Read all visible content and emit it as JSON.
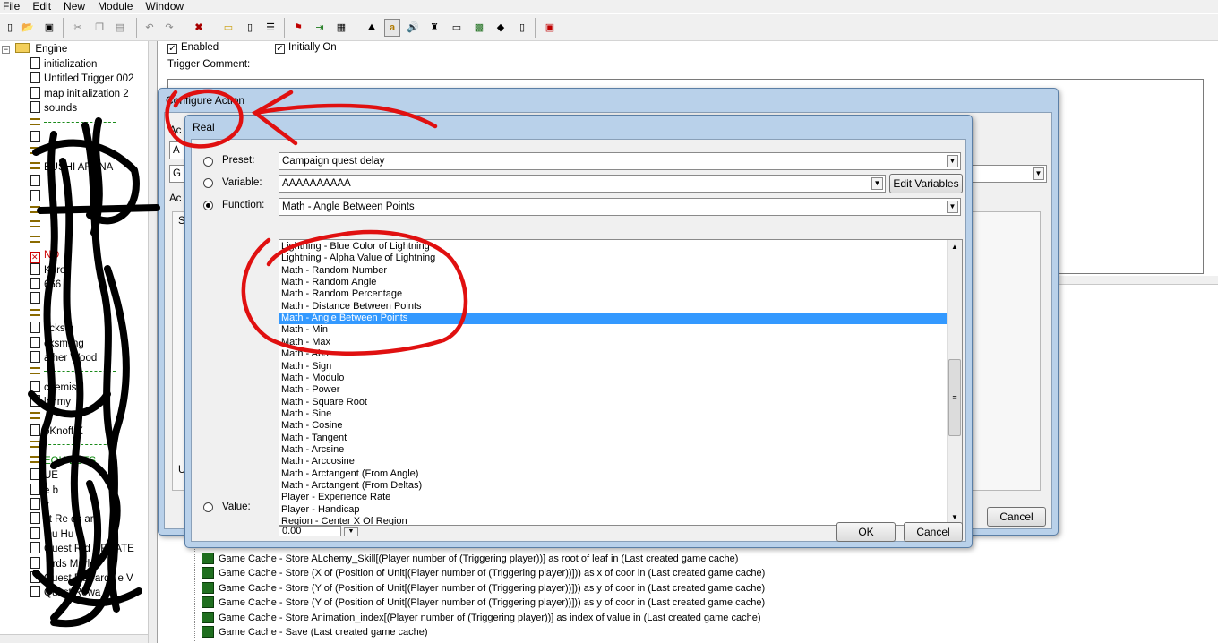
{
  "menu": [
    "File",
    "Edit",
    "New",
    "Module",
    "Window"
  ],
  "toolbar_icons": [
    "new-icon",
    "open-icon",
    "save-icon",
    "cut-icon",
    "copy-icon",
    "paste-icon",
    "undo-icon",
    "redo-icon",
    "close-icon",
    "folder-icon",
    "page-icon",
    "list-icon",
    "flag-icon",
    "export-icon",
    "clapper-icon",
    "terrain-icon",
    "font-icon",
    "sound-icon",
    "unit-icon",
    "map-icon",
    "script-icon",
    "cube-icon",
    "document-icon",
    "test-icon"
  ],
  "tree": {
    "root": "Engine",
    "items": [
      {
        "label": "initialization",
        "icon": "page"
      },
      {
        "label": "Untitled Trigger 002",
        "icon": "page"
      },
      {
        "label": "map initialization 2",
        "icon": "page"
      },
      {
        "label": "sounds",
        "icon": "page"
      },
      {
        "label": "",
        "icon": "comment-dash"
      },
      {
        "label": "",
        "icon": "page"
      },
      {
        "label": "",
        "icon": "comment"
      },
      {
        "label": "BUSHI ARENA",
        "icon": "comment"
      },
      {
        "label": "",
        "icon": "page"
      },
      {
        "label": "",
        "icon": "page"
      },
      {
        "label": "",
        "icon": "comment"
      },
      {
        "label": "",
        "icon": "comment"
      },
      {
        "label": "",
        "icon": "comment"
      },
      {
        "label": "NO",
        "icon": "disabled"
      },
      {
        "label": "Kero",
        "icon": "page"
      },
      {
        "label": "666",
        "icon": "page"
      },
      {
        "label": "",
        "icon": "page"
      },
      {
        "label": "",
        "icon": "comment-dash"
      },
      {
        "label": "acksm",
        "icon": "page"
      },
      {
        "label": "cksmiing",
        "icon": "page"
      },
      {
        "label": "ather Wood",
        "icon": "page"
      },
      {
        "label": "",
        "icon": "comment-dash"
      },
      {
        "label": "chemist",
        "icon": "page"
      },
      {
        "label": "lchmy",
        "icon": "page"
      },
      {
        "label": "",
        "icon": "comment-dash"
      },
      {
        "label": "oKnoff X",
        "icon": "page"
      },
      {
        "label": "",
        "icon": "comment-dash"
      },
      {
        "label": "EQU   ESTS",
        "icon": "comment"
      },
      {
        "label": "UE",
        "icon": "page"
      },
      {
        "label": "e b",
        "icon": "page"
      },
      {
        "label": "y",
        "icon": "page"
      },
      {
        "label": "st Re    ds ars",
        "icon": "page"
      },
      {
        "label": "Qu    Hu",
        "icon": "page"
      },
      {
        "label": "Quest R    d CREATE",
        "icon": "page"
      },
      {
        "label": "    ards Murloc",
        "icon": "page"
      },
      {
        "label": "Quest Rewards    e V",
        "icon": "page"
      },
      {
        "label": "Quest Rewa",
        "icon": "page"
      }
    ]
  },
  "trigger": {
    "enabled_label": "Enabled",
    "initially_on_label": "Initially On",
    "comment_label": "Trigger Comment:"
  },
  "actions": [
    "Game Cache - Store ALchemy_Skill[(Player number of (Triggering player))] as root of leaf in (Last created game cache)",
    "Game Cache - Store (X of (Position of Unit[(Player number of (Triggering player))])) as x of coor in (Last created game cache)",
    "Game Cache - Store (Y of (Position of Unit[(Player number of (Triggering player))])) as y of coor in (Last created game cache)",
    "Game Cache - Store (Y of (Position of Unit[(Player number of (Triggering player))])) as y of coor in (Last created game cache)",
    "Game Cache - Store Animation_index[(Player number of (Triggering player))] as index of value in (Last created game cache)",
    "Game Cache - Save (Last created game cache)"
  ],
  "configure_dialog": {
    "title": "Configure Action",
    "partial_labels": [
      "Ac",
      "A",
      "G",
      "Ac",
      "S",
      "U"
    ],
    "cancel_label": "Cancel"
  },
  "real_dialog": {
    "title": "Real",
    "preset_label": "Preset:",
    "preset_value": "Campaign quest delay",
    "variable_label": "Variable:",
    "variable_value": "AAAAAAAAAA",
    "edit_variables_label": "Edit Variables",
    "function_label": "Function:",
    "function_value": "Math - Angle Between Points",
    "value_label": "Value:",
    "value_value": "0.00",
    "ok_label": "OK",
    "cancel_label": "Cancel",
    "options": [
      "Lightning - Blue Color of Lightning",
      "Lightning - Alpha Value of Lightning",
      "Math - Random Number",
      "Math - Random Angle",
      "Math - Random Percentage",
      "Math - Distance Between Points",
      "Math - Angle Between Points",
      "Math - Min",
      "Math - Max",
      "Math - Abs",
      "Math - Sign",
      "Math - Modulo",
      "Math - Power",
      "Math - Square Root",
      "Math - Sine",
      "Math - Cosine",
      "Math - Tangent",
      "Math - Arcsine",
      "Math - Arccosine",
      "Math - Arctangent (From Angle)",
      "Math - Arctangent (From Deltas)",
      "Player - Experience Rate",
      "Player - Handicap",
      "Region - Center X Of Region"
    ],
    "selected_index": 6
  },
  "colors": {
    "selection": "#3399ff",
    "annotation": "#e01010",
    "scribble": "#000000"
  }
}
